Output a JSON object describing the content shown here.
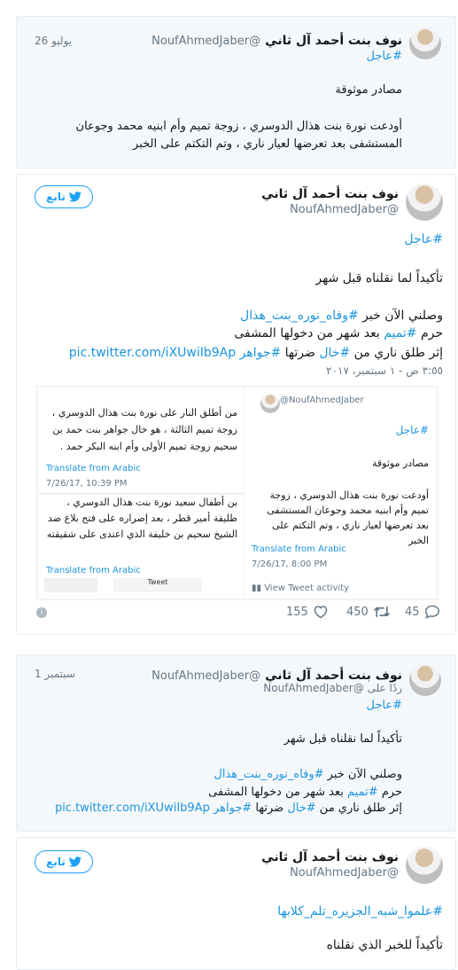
{
  "tweet1": {
    "name": "نوف بنت أحمد آل ثاني",
    "handle": "@NoufAhmedJaber",
    "date": "26 يوليو",
    "hashtag": "#عاجل",
    "line1": "مصادر موثوقة",
    "line2": "أودعت نورة بنت هذال الدوسري ، زوجة تميم وأم ابنيه محمد وجوعان المستشفى بعد تعرضها لعيار ناري ، وتم التكتم على الخبر"
  },
  "tweet2": {
    "name": "نوف بنت أحمد آل ثاني",
    "handle": "@NoufAhmedJaber",
    "follow_label": "تابع",
    "hashtag": "#عاجل",
    "line1": "تأكيداً لما نقلناه قبل شهر",
    "line2a": "وصلني الآن خبر ",
    "line2b": "#وفاه_نوره_بنت_هذال",
    "line3a": "حرم ",
    "line3b": "#تميم",
    "line3c": " بعد شهر من دخولها المشفى",
    "line4a": "إثر طلق ناري من ",
    "line4b": "#خال",
    "line4c": " ضرتها ",
    "line4d": "#جواهر",
    "line4e": " pic.twitter.com/iXUwiIb9Ap",
    "timestamp": "٣:٥٥ ص - ١ سبتمبر، ٢٠١٧",
    "media": {
      "left_text": "من أطلق النار على نورة بنت هذال الدوسري ، زوجة تميم الثالثة ، هو خال جواهر بنت حمد بن سحيم زوجة تميم الأولى وأم ابنه البكر حمد .",
      "left_translate": "Translate from Arabic",
      "left_date": "7/26/17, 10:39 PM",
      "left_text2": "بن أطفال سعيد نورة بنت هذال الدوسري ، طليقة أمير قطر ، بعد إصراره على فتح بلاغ ضد الشيخ سحيم بن خليفة الذي اعتدى على شقيقته",
      "left_translate2": "Translate from Arabic",
      "left_tweet_label": "Tweet",
      "right_handle": "@NoufAhmedJaber",
      "right_hashtag": "#عاجل",
      "right_line1": "مصادر موثوقة",
      "right_line2": "أودعت نورة بنت هذال الدوسري ، زوجة تميم وأم ابنيه محمد وجوعان المستشفى بعد تعرضها لعيار ناري ، وتم التكتم على الخبر",
      "right_translate": "Translate from Arabic",
      "right_date": "7/26/17, 8:00 PM",
      "right_activity": "View Tweet activity"
    },
    "likes": "155",
    "retweets": "450",
    "replies": "45"
  },
  "tweet3": {
    "name": "نوف بنت أحمد آل ثاني",
    "handle": "@NoufAhmedJaber",
    "date": "1 سبتمبر",
    "reply_to_prefix": "ردًا على ",
    "reply_to": "@NoufAhmedJaber",
    "hashtag": "#عاجل",
    "line1": "تأكيداً لما نقلناه قبل شهر",
    "line2a": "وصلني الآن خبر ",
    "line2b": "#وفاه_نوره_بنت_هذال",
    "line3a": "حرم ",
    "line3b": "#تميم",
    "line3c": " بعد شهر من دخولها المشفى",
    "line4a": "إثر طلق ناري من ",
    "line4b": "#خال",
    "line4c": " ضرتها ",
    "line4d": "#جواهر",
    "line4e": " pic.twitter.com/iXUwiIb9Ap"
  },
  "tweet4": {
    "name": "نوف بنت أحمد آل ثاني",
    "handle": "@NoufAhmedJaber",
    "follow_label": "تابع",
    "hashtag": "#علموا_شبه_الجزيره_تلم_كلابها",
    "line1": "تأكيداً للخبر الذي نقلناه"
  },
  "colors": {
    "accent": "#1da1f2",
    "link": "#1b95e0",
    "muted": "#657786",
    "heart": "#e0245e"
  },
  "icons": [
    "twitter-bird-icon",
    "heart-icon",
    "retweet-icon",
    "reply-icon",
    "info-icon"
  ]
}
